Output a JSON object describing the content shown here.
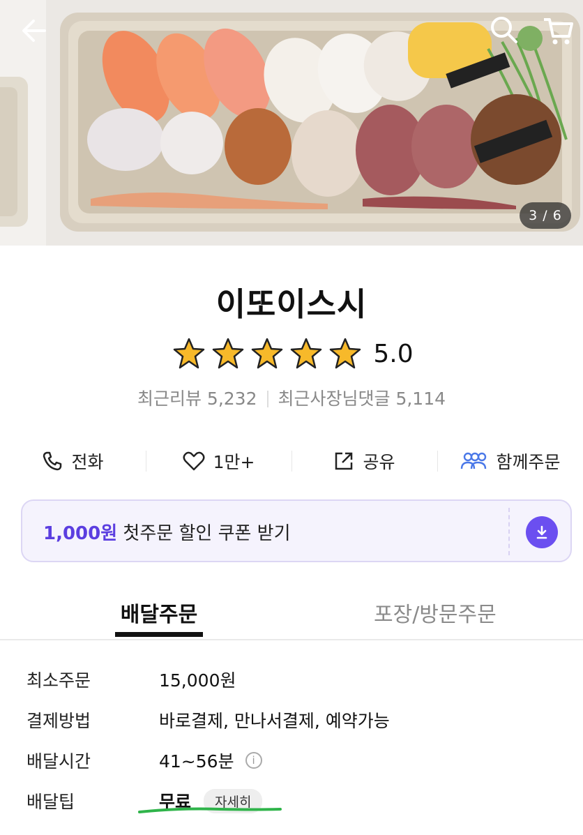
{
  "hero": {
    "counter": "3 / 6",
    "icons": {
      "back": "back-arrow-icon",
      "search": "search-icon",
      "cart": "cart-icon"
    }
  },
  "store": {
    "name": "이또이스시",
    "rating": 5.0,
    "rating_text": "5.0",
    "stars_filled": 5,
    "stars_total": 5,
    "recent_reviews": "최근리뷰 5,232",
    "owner_replies": "최근사장님댓글 5,114"
  },
  "actions": [
    {
      "label": "전화",
      "icon": "phone-icon"
    },
    {
      "label": "1만+",
      "icon": "heart-icon"
    },
    {
      "label": "공유",
      "icon": "share-icon"
    },
    {
      "label": "함께주문",
      "icon": "group-order-icon"
    }
  ],
  "coupon": {
    "amount": "1,000원",
    "text": " 첫주문 할인 쿠폰 받기",
    "icon": "download-icon",
    "accent": "#6b4ff0"
  },
  "tabs": [
    {
      "label": "배달주문",
      "active": true
    },
    {
      "label": "포장/방문주문",
      "active": false
    }
  ],
  "info": {
    "min_order": {
      "label": "최소주문",
      "value": "15,000원"
    },
    "payment": {
      "label": "결제방법",
      "value": "바로결제, 만나서결제, 예약가능"
    },
    "delivery_time": {
      "label": "배달시간",
      "value": "41~56분",
      "icon": "info-icon",
      "icon_glyph": "i"
    },
    "delivery_tip": {
      "label": "배달팁",
      "value": "무료",
      "detail": "자세히"
    }
  },
  "colors": {
    "accent": "#5b3ee0",
    "highlight": "#2fb44a"
  }
}
